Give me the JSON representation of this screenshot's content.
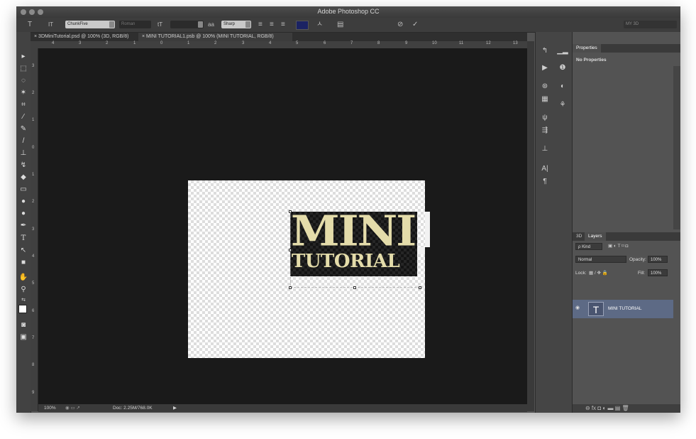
{
  "app": {
    "title": "Adobe Photoshop CC"
  },
  "options": {
    "tool_glyph": "T",
    "orient_glyph": "IT",
    "font_family": "ChunkFive",
    "font_style": "Roman",
    "size_glyph": "tT",
    "aa_label": "aa",
    "aa_value": "Sharp",
    "workspace": "MY 3D",
    "cancel_glyph": "⊘",
    "commit_glyph": "✓"
  },
  "tabs": [
    {
      "close": "×",
      "label": "3DMiniTutorial.psd @ 100% (3D, RGB/8)"
    },
    {
      "close": "×",
      "label": "MINI TUTORIAL1.psb @ 100% (MINI TUTORIAL, RGB/8)"
    }
  ],
  "ruler_h": [
    "4",
    "3",
    "2",
    "1",
    "0",
    "1",
    "2",
    "3",
    "4",
    "5",
    "6",
    "7",
    "8",
    "9",
    "10",
    "11",
    "12",
    "13"
  ],
  "ruler_v": [
    "3",
    "2",
    "1",
    "0",
    "1",
    "2",
    "3",
    "4",
    "5",
    "6",
    "7",
    "8",
    "9"
  ],
  "canvas": {
    "line1": "MINI",
    "line2": "TUTORIAL"
  },
  "status": {
    "zoom": "100%",
    "doc": "Doc: 2.25M/768.0K",
    "arrow": "▶"
  },
  "properties": {
    "tab": "Properties",
    "message": "No Properties"
  },
  "layers": {
    "tab_3d": "3D",
    "tab_layers": "Layers",
    "kind": "ρ Kind",
    "blend": "Normal",
    "opacity_label": "Opacity:",
    "opacity": "100%",
    "lock_label": "Lock:",
    "fill_label": "Fill:",
    "fill": "100%",
    "layer_name": "MINI TUTORIAL",
    "layer_thumb": "T",
    "footer": "⊖  fx  ◘  ◐  ▬  ▤  🗑"
  },
  "colors": {
    "accent": "#e4dcaa",
    "selection": "#5d6a85",
    "swatch": "#1b2363"
  }
}
